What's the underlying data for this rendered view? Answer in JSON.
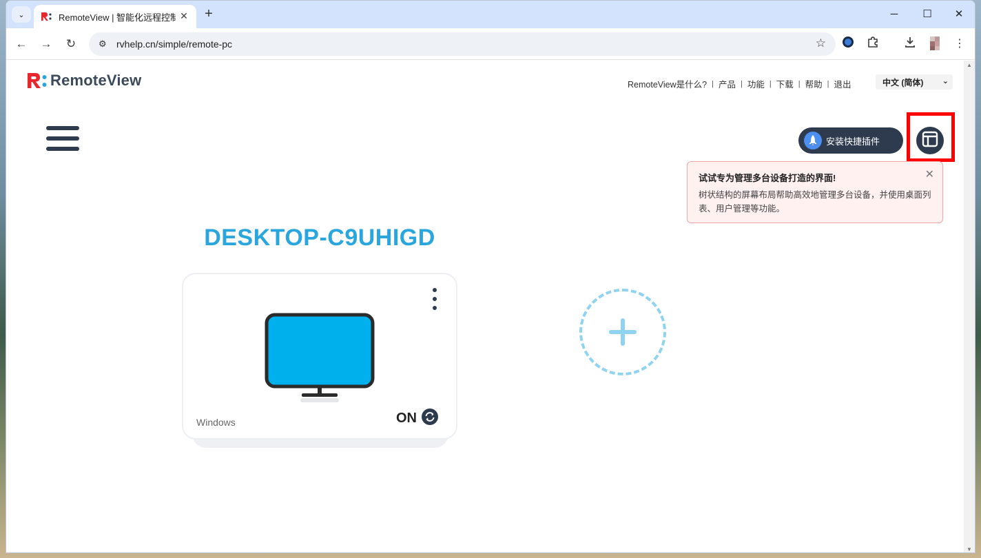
{
  "browser": {
    "tab_title": "RemoteView | 智能化远程控制",
    "url": "rvhelp.cn/simple/remote-pc",
    "new_tab_symbol": "+",
    "tab_close_symbol": "✕",
    "minimize_symbol": "─",
    "maximize_symbol": "☐",
    "close_symbol": "✕"
  },
  "header": {
    "logo_text": "RemoteView",
    "nav": [
      "RemoteView是什么?",
      "产品",
      "功能",
      "下载",
      "帮助",
      "退出"
    ],
    "language": "中文 (简体)"
  },
  "toolbar": {
    "install_plugin_label": "安装快捷插件"
  },
  "tooltip": {
    "title": "试试专为管理多台设备打造的界面!",
    "body": "树状结构的屏幕布局帮助高效地管理多台设备，并使用桌面列表、用户管理等功能。"
  },
  "device": {
    "name": "DESKTOP-C9UHIGD",
    "os": "Windows",
    "status": "ON",
    "screen_color": "#00b0ec"
  },
  "colors": {
    "accent": "#2aa6df",
    "dark": "#2e3a4e",
    "brand_red": "#e8262d",
    "highlight": "#ff0000"
  }
}
